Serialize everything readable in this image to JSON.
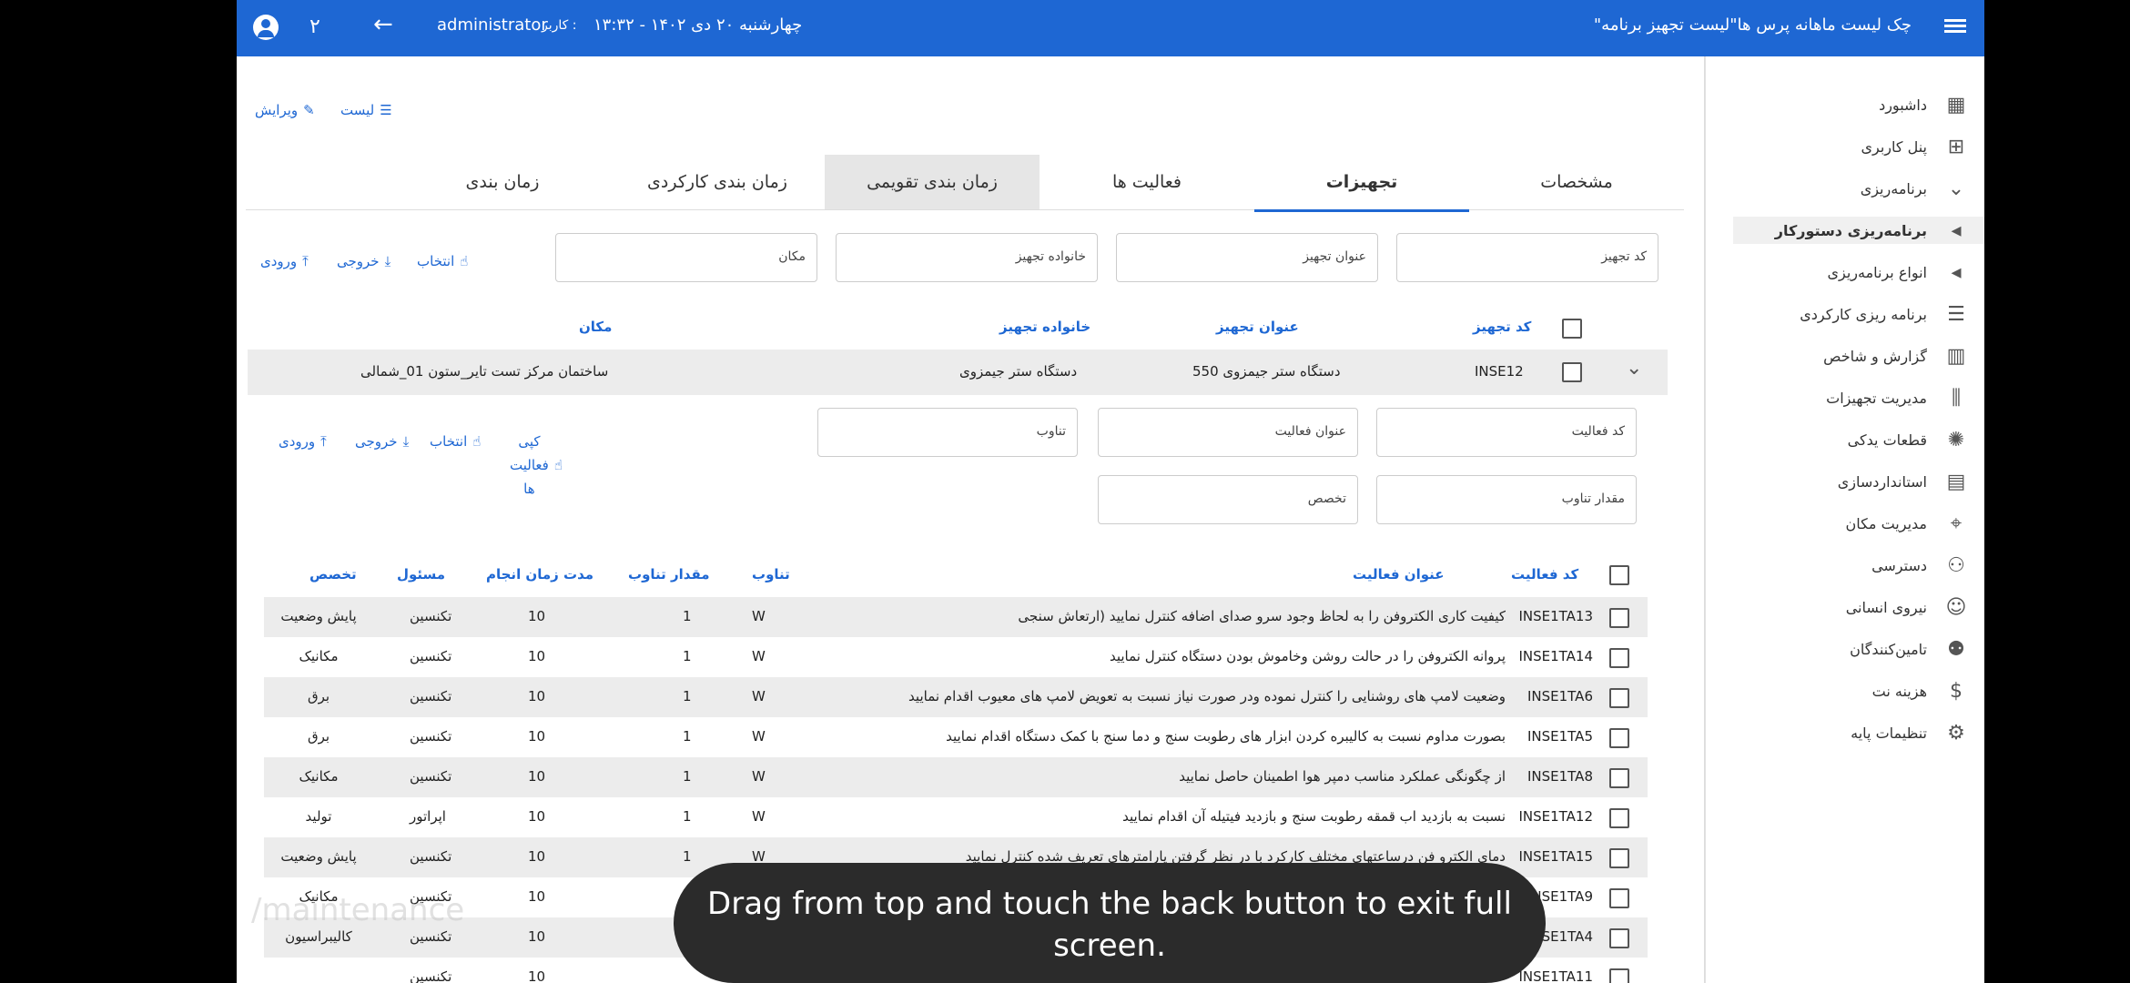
{
  "topbar": {
    "title": "\"چک لیست ماهانه پرس ها\"لیست تجهیز برنامه",
    "datetime": "چهارشنبه ۲۰ دی ۱۴۰۲ - ۱۳:۳۲",
    "user_label": "کاربر :",
    "user_name": "administrator",
    "num": "۲"
  },
  "actions_top": {
    "list": "لیست",
    "edit": "ویرایش"
  },
  "tabs": [
    "مشخصات",
    "تجهیزات",
    "فعالیت ها",
    "زمان بندی تقویمی",
    "زمان بندی کارکردی",
    "زمان بندی"
  ],
  "equipment_filters": {
    "code": "کد تجهیز",
    "title": "عنوان تجهیز",
    "family": "خانواده تجهیز",
    "location": "مکان"
  },
  "equipment_actions": {
    "select": "انتخاب",
    "export": "خروجی",
    "import": "ورودی"
  },
  "equipment_table": {
    "headers": [
      "کد تجهیز",
      "عنوان تجهیز",
      "خانواده تجهیز",
      "مکان"
    ],
    "row": {
      "code": "INSE12",
      "title": "دستگاه ستر جیمزوی 550",
      "family": "دستگاه ستر جیمزوی",
      "location": "ساختمان مرکز تست تایر_ستون 01_شمالی"
    }
  },
  "activity_filters": {
    "code": "کد فعالیت",
    "title": "عنوان فعالیت",
    "frequency": "تناوب",
    "freq_value": "مقدار تناوب",
    "specialty": "تخصص"
  },
  "activity_actions": {
    "copy_l1": "کپی",
    "copy_l2": "فعالیت",
    "copy_l3": "ها",
    "select": "انتخاب",
    "export": "خروجی",
    "import": "ورودی"
  },
  "activity_table": {
    "headers": [
      "کد فعالیت",
      "عنوان فعالیت",
      "تناوب",
      "مقدار تناوب",
      "مدت زمان انجام",
      "مسئول",
      "تخصص"
    ],
    "rows": [
      [
        "INSE1TA13",
        "کیفیت کاری الکتروفن را به لحاظ وجود سرو صدای اضافه کنترل نمایید (ارتعاش سنجی",
        "W",
        "1",
        "10",
        "تکنسین",
        "پایش وضعیت"
      ],
      [
        "INSE1TA14",
        "پروانه الکتروفن را در حالت روشن وخاموش بودن دستگاه کنترل نمایید",
        "W",
        "1",
        "10",
        "تکنسین",
        "مکانیک"
      ],
      [
        "INSE1TA6",
        "وضعیت لامپ های روشنایی را کنترل نموده ودر صورت نیاز نسبت به تعویض لامپ های معیوب اقدام نمایید",
        "W",
        "1",
        "10",
        "تکنسین",
        "برق"
      ],
      [
        "INSE1TA5",
        "بصورت مداوم نسبت به کالیبره کردن ابزار های رطوبت سنج و دما سنج با کمک دستگاه اقدام نمایید",
        "W",
        "1",
        "10",
        "تکنسین",
        "برق"
      ],
      [
        "INSE1TA8",
        "از چگونگی عملکرد مناسب دمپر هوا اطمینان حاصل نمایید",
        "W",
        "1",
        "10",
        "تکنسین",
        "مکانیک"
      ],
      [
        "INSE1TA12",
        "نسبت به بازدید اب قمقه رطوبت سنج و بازدید فیتیله آن اقدام نمایید",
        "W",
        "1",
        "10",
        "اپراتور",
        "تولید"
      ],
      [
        "INSE1TA15",
        "دمای الکترو فن درساعتهای مختلف کارکرد با در نظر گرفتن پارامترهای تعریف شده کنترل نمایید",
        "W",
        "1",
        "10",
        "تکنسین",
        "پایش وضعیت"
      ],
      [
        "INSE1TA9",
        "",
        "",
        "",
        "10",
        "تکنسین",
        "مکانیک"
      ],
      [
        "INSE1TA4",
        "",
        "",
        "",
        "10",
        "تکنسین",
        "کالیبراسیون"
      ],
      [
        "INSE1TA11",
        "",
        "",
        "",
        "10",
        "تکنسین",
        ""
      ]
    ]
  },
  "sidebar": {
    "items": [
      {
        "label": "داشبورد",
        "icon": "dashboard-icon"
      },
      {
        "label": "پنل کاربری",
        "icon": "plus-box-icon"
      },
      {
        "label": "برنامه‌ریزی",
        "icon": "chevron-down-icon"
      },
      {
        "label": "برنامه‌ریزی دستورکار",
        "icon": "caret-left-icon"
      },
      {
        "label": "انواع برنامه‌ریزی",
        "icon": "caret-left-icon"
      },
      {
        "label": "برنامه ریزی کارکردی",
        "icon": "list-icon"
      },
      {
        "label": "گزارش و شاخص",
        "icon": "chart-icon"
      },
      {
        "label": "مدیریت تجهیزات",
        "icon": "equipment-icon"
      },
      {
        "label": "قطعات یدکی",
        "icon": "parts-icon"
      },
      {
        "label": "استانداردسازی",
        "icon": "clipboard-icon"
      },
      {
        "label": "مدیریت مکان",
        "icon": "location-icon"
      },
      {
        "label": "دسترسی",
        "icon": "add-person-icon"
      },
      {
        "label": "نیروی انسانی",
        "icon": "person-icon"
      },
      {
        "label": "تامین‌کنندگان",
        "icon": "people-icon"
      },
      {
        "label": "هزینه نت",
        "icon": "dollar-icon"
      },
      {
        "label": "تنظیمات پایه",
        "icon": "gear-icon"
      }
    ]
  },
  "toast": {
    "line1": "Drag from top and touch the back button to exit full",
    "line2": "screen."
  },
  "watermark": "/maintenance",
  "colors": {
    "primary": "#1e67d3",
    "row_alt": "#ececec"
  }
}
